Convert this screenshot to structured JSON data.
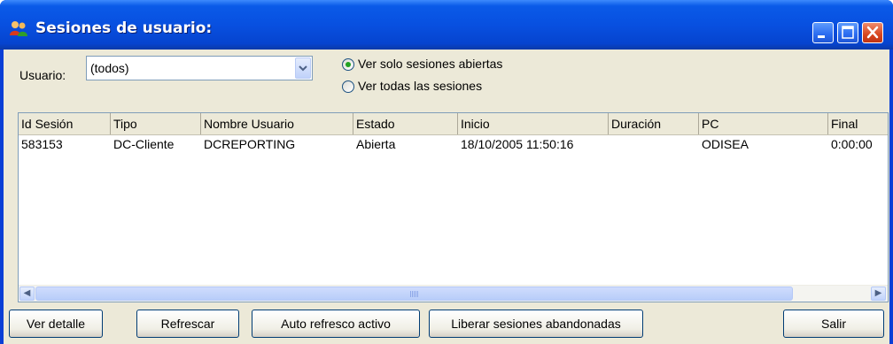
{
  "window": {
    "title": "Sesiones de usuario:"
  },
  "filter": {
    "user_label": "Usuario:",
    "user_value": "(todos)",
    "radio_open_label": "Ver solo sesiones abiertas",
    "radio_all_label": "Ver todas las sesiones",
    "selected": "open"
  },
  "table": {
    "columns": [
      "Id Sesión",
      "Tipo",
      "Nombre Usuario",
      "Estado",
      "Inicio",
      "Duración",
      "PC",
      "Final"
    ],
    "rows": [
      [
        "583153",
        "DC-Cliente",
        "DCREPORTING",
        "Abierta",
        "18/10/2005 11:50:16",
        "",
        "ODISEA",
        "0:00:00"
      ]
    ]
  },
  "buttons": {
    "detail": "Ver detalle",
    "refresh": "Refrescar",
    "auto_refresh": "Auto refresco activo",
    "release": "Liberar sesiones abandonadas",
    "exit": "Salir"
  }
}
